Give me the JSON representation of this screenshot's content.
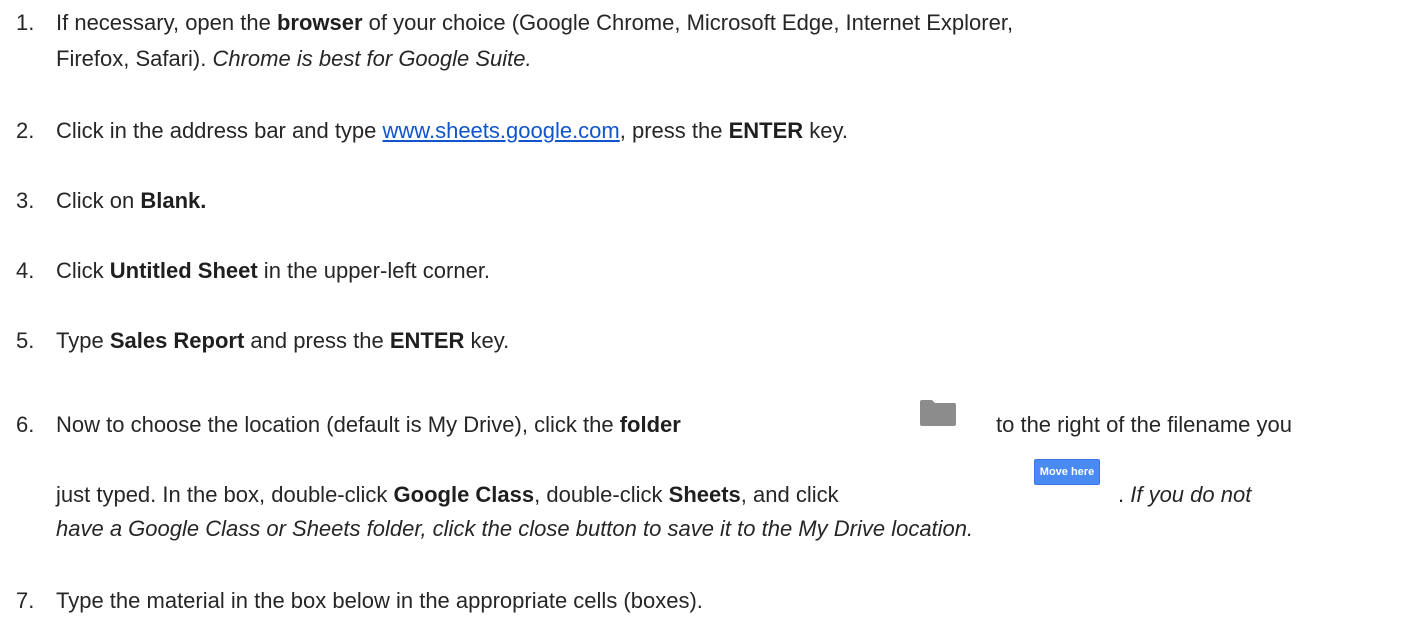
{
  "steps": [
    {
      "num": "1.",
      "line1": {
        "a": "If necessary, open the ",
        "b": "browser",
        "c": " of your choice (Google Chrome, Microsoft Edge, Internet Explorer,"
      },
      "line2": {
        "a": "Firefox, Safari). ",
        "italic": "Chrome is best for Google Suite."
      }
    },
    {
      "num": "2.",
      "a": "Click in the address bar and type ",
      "link": "www.sheets.google.com",
      "b": ", press the ",
      "bold": "ENTER",
      "c": " key."
    },
    {
      "num": "3.",
      "a": "Click on ",
      "bold": "Blank."
    },
    {
      "num": "4.",
      "a": "Click ",
      "bold": "Untitled Sheet",
      "b": " in the upper-left corner."
    },
    {
      "num": "5.",
      "a": "Type ",
      "bold1": "Sales Report",
      "b": " and press the ",
      "bold2": "ENTER",
      "c": " key."
    },
    {
      "num": "6.",
      "line1": {
        "a": "Now to choose the location (default is My Drive), click the ",
        "bold": "folder",
        "b": "to the right of the filename you"
      },
      "line2": {
        "a": "just typed. In the box, double-click ",
        "bold1": "Google Class",
        "b": ", double-click ",
        "bold2": "Sheets",
        "c": ", and click",
        "d": ". ",
        "italic": "If you do not"
      },
      "line3": {
        "italic": "have a Google Class or Sheets folder, click the close button to save it to the My Drive location."
      },
      "button_label": "Move here",
      "folder_icon": "folder-icon",
      "folder_color": "#8c8c8c"
    },
    {
      "num": "7.",
      "a": "Type the material in the box below in the appropriate cells (boxes)."
    }
  ],
  "colors": {
    "text": "#262626",
    "link": "#1155cc",
    "button_bg": "#4a8af4"
  }
}
